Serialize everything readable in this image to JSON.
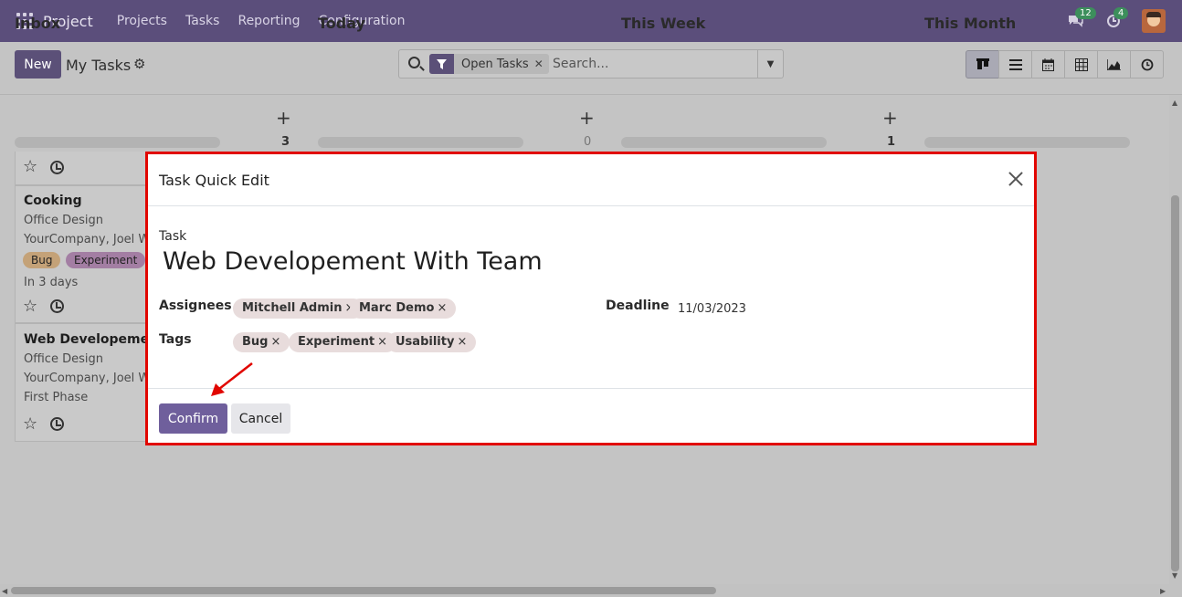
{
  "navbar": {
    "app_name": "Project",
    "menu": [
      "Projects",
      "Tasks",
      "Reporting",
      "Configuration"
    ],
    "messages_count": "12",
    "activities_count": "4"
  },
  "control_panel": {
    "new_label": "New",
    "title": "My Tasks",
    "search": {
      "facet_label": "Open Tasks",
      "placeholder": "Search..."
    }
  },
  "kanban": {
    "columns": [
      {
        "name": "Inbox",
        "count": "3"
      },
      {
        "name": "Today",
        "count": "0"
      },
      {
        "name": "This Week",
        "count": "1"
      },
      {
        "name": "This Month",
        "count": ""
      }
    ],
    "cards": [
      {
        "title": "Cooking",
        "project": "Office Design",
        "assignees": "YourCompany, Joel W",
        "tags": [
          "Bug",
          "Experiment"
        ],
        "due": "In 3 days"
      },
      {
        "title": "Web Developemen",
        "project": "Office Design",
        "assignees": "YourCompany, Joel W",
        "stage": "First Phase"
      }
    ]
  },
  "modal": {
    "title": "Task Quick Edit",
    "task_label": "Task",
    "task_name": "Web Developement With Team",
    "assignees_label": "Assignees",
    "assignees": [
      "Mitchell Admin",
      "Marc Demo"
    ],
    "tags_label": "Tags",
    "tags": [
      "Bug",
      "Experiment",
      "Usability"
    ],
    "deadline_label": "Deadline",
    "deadline": "11/03/2023",
    "confirm_label": "Confirm",
    "cancel_label": "Cancel"
  },
  "colors": {
    "navbar": "#5b4e7b",
    "primary": "#6f5f9c",
    "highlight_border": "#e10600",
    "annotation_arrow": "#e10600"
  }
}
